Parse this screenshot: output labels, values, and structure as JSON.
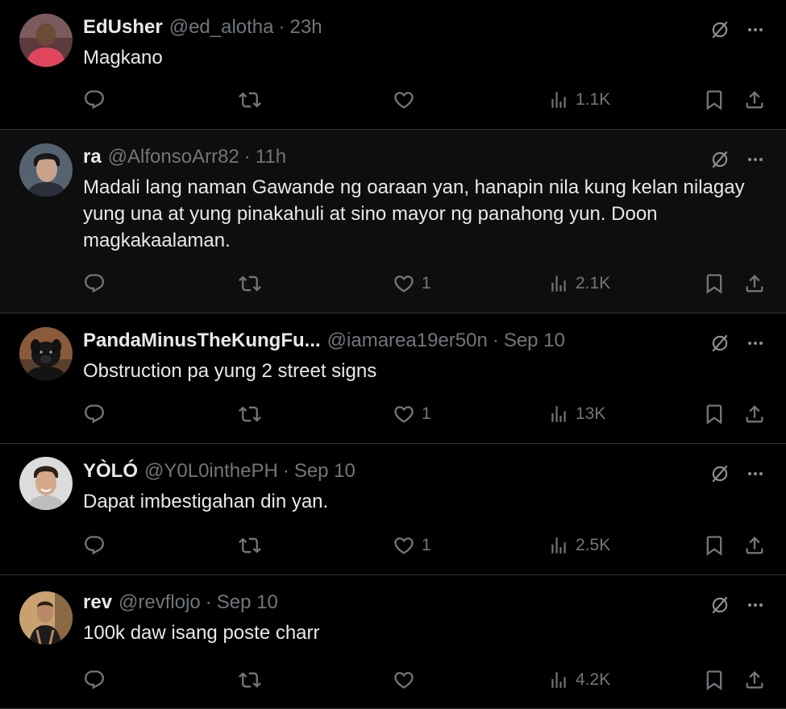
{
  "colors": {
    "background": "#000000",
    "highlight_background": "#0e0e0e",
    "text_primary": "#e7e9ea",
    "text_secondary": "#71767b",
    "divider": "#2f3336"
  },
  "posts": [
    {
      "display_name": "EdUsher",
      "handle": "@ed_alotha",
      "separator": "·",
      "time": "23h",
      "text": "Magkano",
      "likes": "",
      "views": "1.1K",
      "avatar": "red-shirt-person-avatar"
    },
    {
      "display_name": "ra",
      "handle": "@AlfonsoArr82",
      "separator": "·",
      "time": "11h",
      "text": "Madali lang naman Gawande ng oaraan yan, hanapin nila kung kelan nilagay yung una at yung pinakahuli at sino mayor ng panahong yun. Doon magkakaalaman.",
      "likes": "1",
      "views": "2.1K",
      "avatar": "dark-hair-man-avatar"
    },
    {
      "display_name": "PandaMinusTheKungFu...",
      "handle": "@iamarea19er50n",
      "separator": "·",
      "time": "Sep 10",
      "text": "Obstruction pa yung 2 street signs",
      "likes": "1",
      "views": "13K",
      "avatar": "black-dog-avatar"
    },
    {
      "display_name": "YÒLÓ",
      "handle": "@Y0L0inthePH",
      "separator": "·",
      "time": "Sep 10",
      "text": "Dapat imbestigahan din yan.",
      "likes": "1",
      "views": "2.5K",
      "avatar": "smiling-man-avatar"
    },
    {
      "display_name": "rev",
      "handle": "@revflojo",
      "separator": "·",
      "time": "Sep 10",
      "text": "100k daw isang poste charr",
      "likes": "",
      "views": "4.2K",
      "avatar": "man-in-tank-top-avatar"
    }
  ],
  "icons": {
    "reply": "reply-icon",
    "repost": "repost-icon",
    "like": "heart-icon",
    "views": "views-chart-icon",
    "bookmark": "bookmark-icon",
    "share": "share-icon",
    "grok": "grok-icon",
    "more": "more-icon"
  }
}
